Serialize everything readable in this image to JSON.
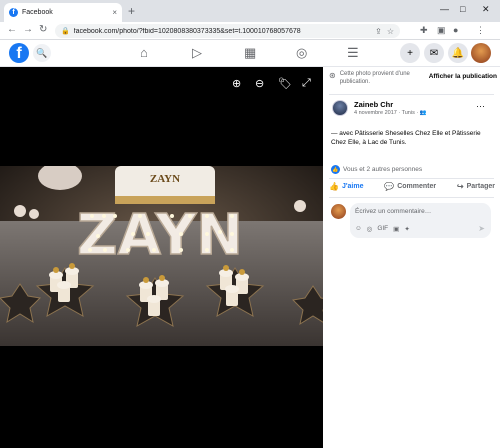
{
  "browser": {
    "tab_title": "Facebook",
    "tab_close": "×",
    "new_tab": "+",
    "win_minimize": "—",
    "win_maximize": "□",
    "win_close": "✕",
    "url": "facebook.com/photo/?fbid=1020808380373335&set=t.100010768057678",
    "back": "←",
    "forward": "→",
    "reload": "↻"
  },
  "fb_header": {
    "logo": "f",
    "notification_count": ""
  },
  "viewer": {
    "zoom_in": "⊕",
    "zoom_out": "⊖",
    "tag": "🏷",
    "fullscreen": "⤢",
    "photo_text": "ZAYN",
    "cake_text": "ZAYN"
  },
  "panel": {
    "share_notice": "Cette photo provient d'une publication.",
    "share_link": "Afficher la publication",
    "author": "Zaineb Chr",
    "meta": "4 novembre 2017 · Tunis ·",
    "more": "···",
    "caption": "— avec Pâtisserie Sheselles Chez Elle et Pâtisserie Chez Elle, à Lac de Tunis.",
    "reactions_text": "Vous et 2 autres personnes",
    "actions": [
      {
        "label": "J'aime",
        "icon": "👍"
      },
      {
        "label": "Commenter",
        "icon": "💬"
      },
      {
        "label": "Partager",
        "icon": "↪"
      }
    ],
    "comment_placeholder": "Écrivez un commentaire…",
    "comment_icons": [
      "☺",
      "◎",
      "GIF",
      "▣",
      "✦"
    ],
    "send_icon": "➤"
  },
  "colors": {
    "fb_blue": "#1877f2",
    "viewer_bg": "#000000",
    "panel_bg": "#ffffff"
  }
}
